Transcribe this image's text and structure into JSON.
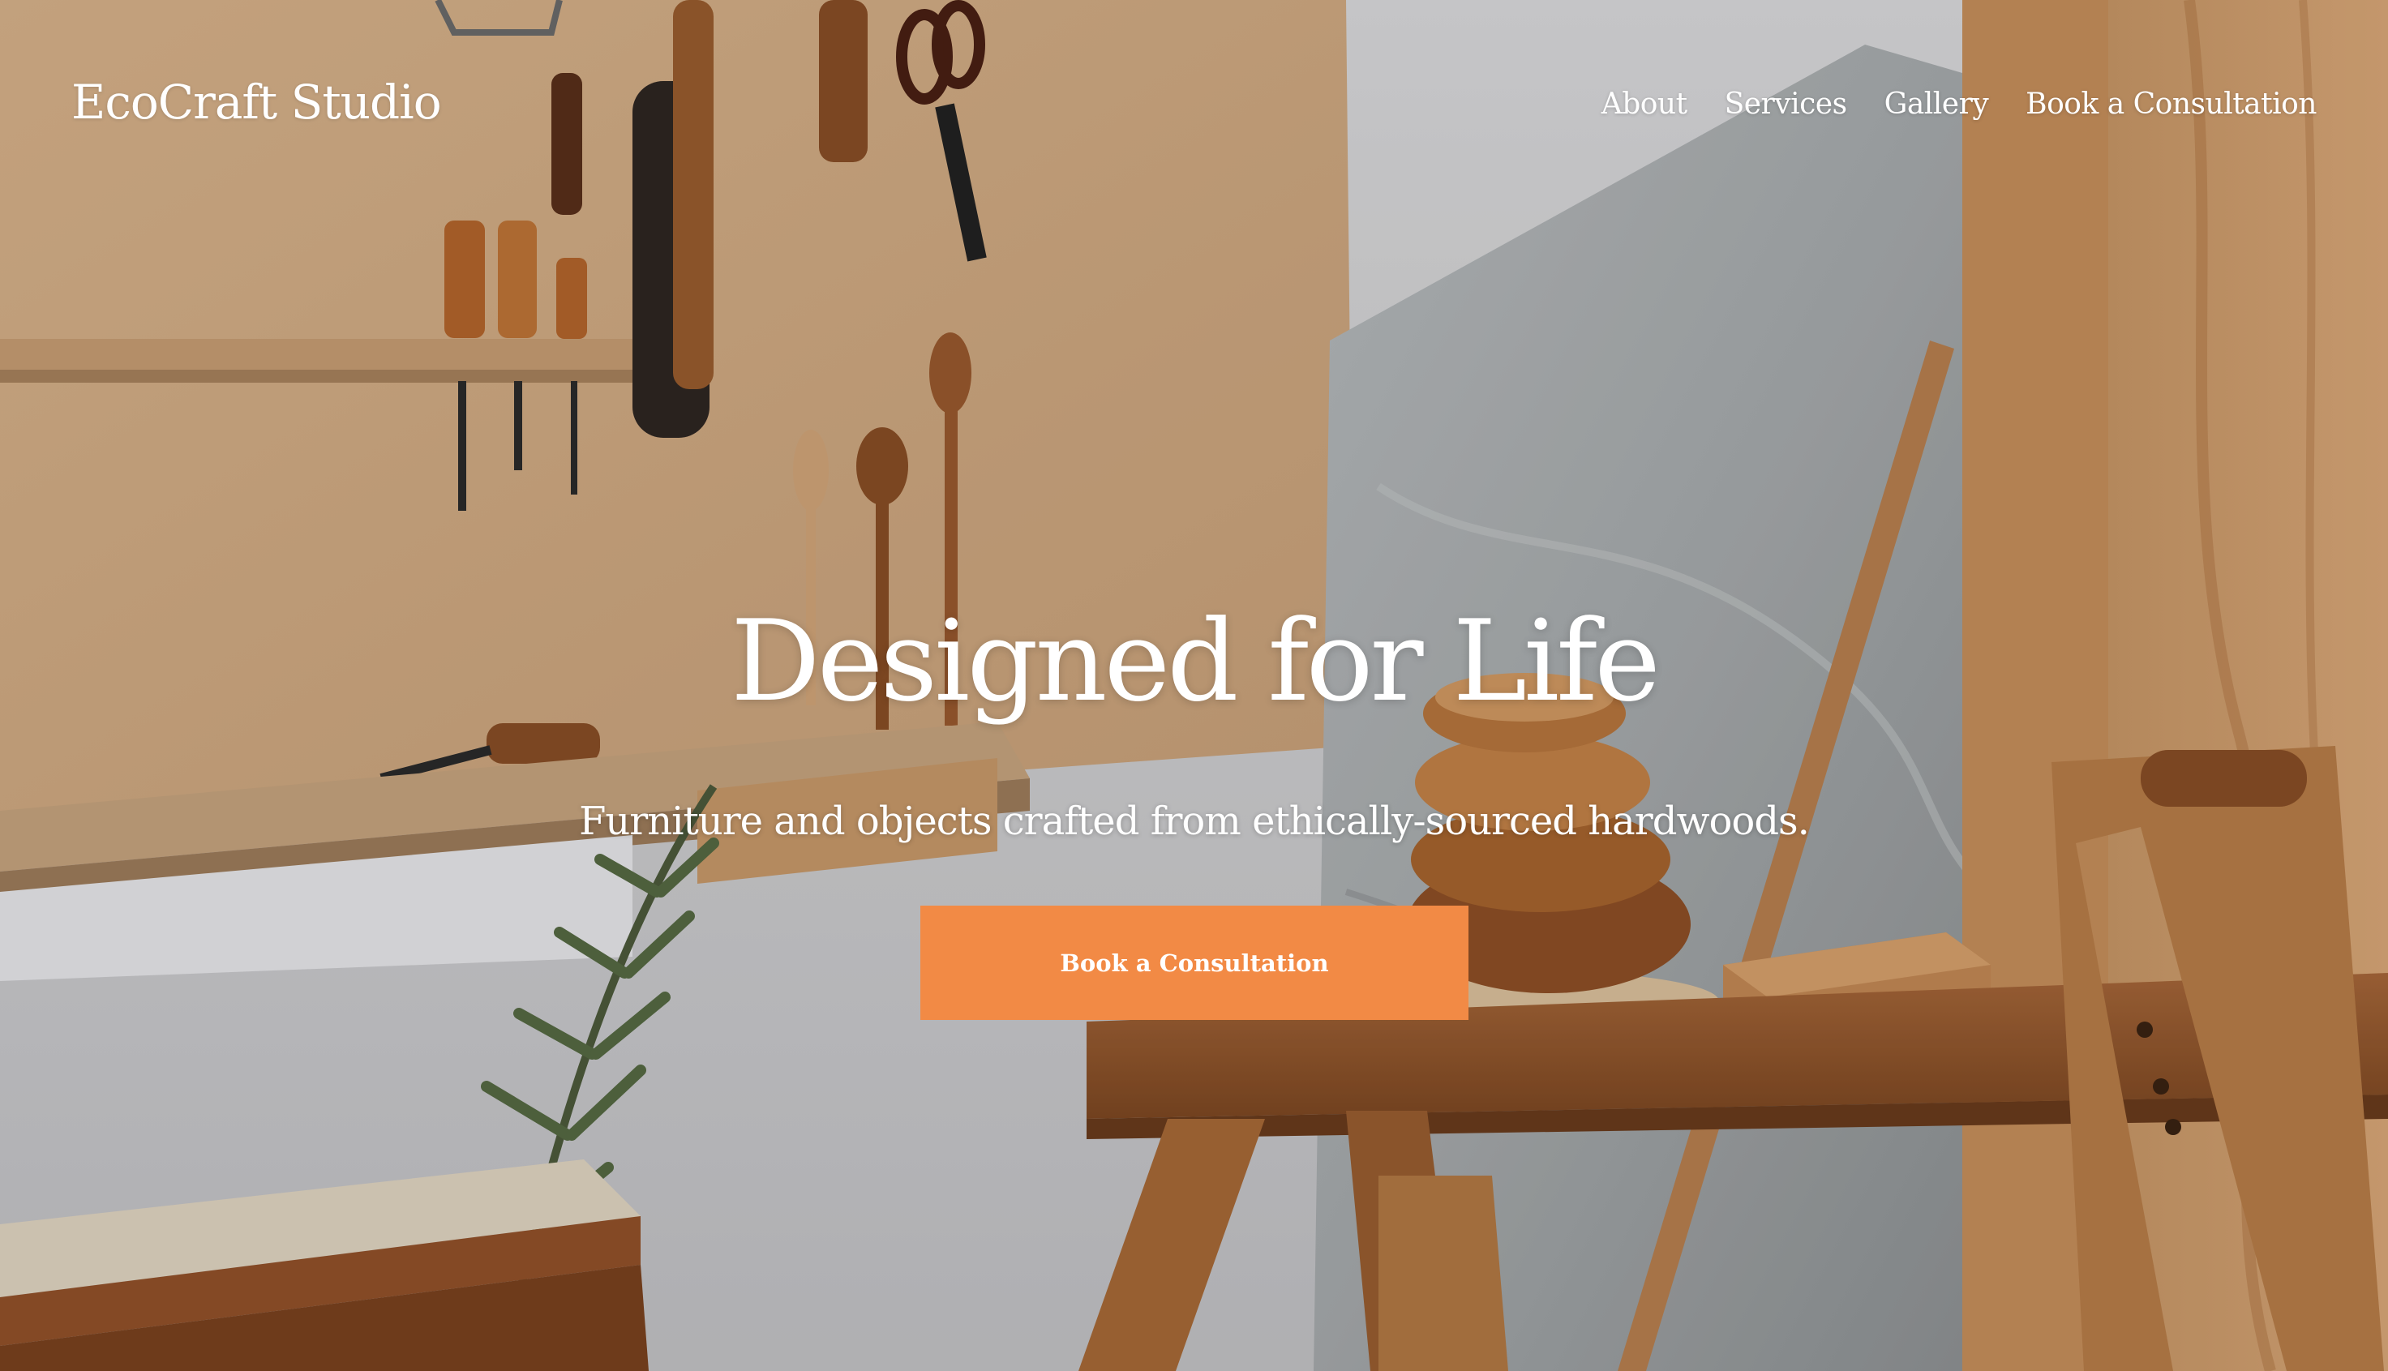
{
  "header": {
    "logo": "EcoCraft Studio",
    "nav": [
      "About",
      "Services",
      "Gallery",
      "Book a Consultation"
    ]
  },
  "hero": {
    "title": "Designed for Life",
    "subtitle": "Furniture and objects crafted from ethically-sourced hardwoods.",
    "cta_label": "Book a Consultation",
    "image": "workshop-background"
  },
  "colors": {
    "accent": "#f28a45",
    "text": "#ffffff"
  }
}
